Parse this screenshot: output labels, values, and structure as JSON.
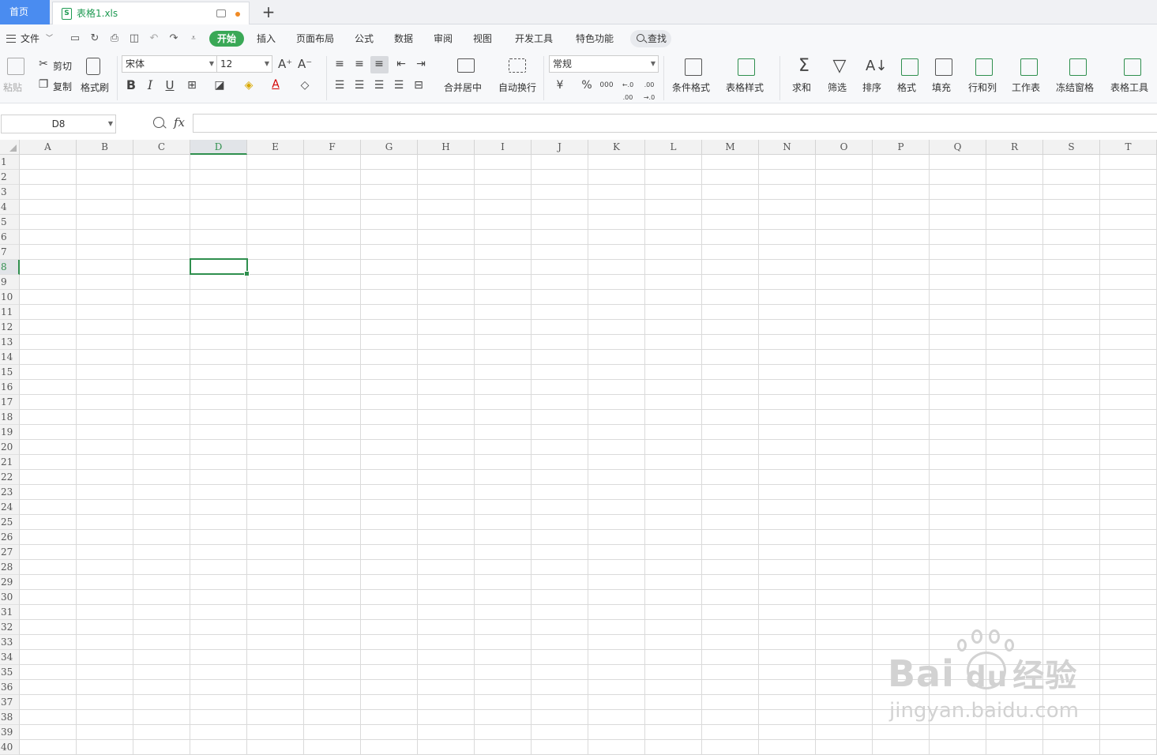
{
  "tabs": {
    "home_label": "首页",
    "doc_title": "表格1.xls",
    "doc_icon": "S"
  },
  "menu": {
    "file": "文件",
    "items": [
      "开始",
      "插入",
      "页面布局",
      "公式",
      "数据",
      "审阅",
      "视图",
      "开发工具",
      "特色功能"
    ],
    "search": "查找"
  },
  "ribbon": {
    "paste": "粘贴",
    "cut": "剪切",
    "copy": "复制",
    "format_painter": "格式刷",
    "font_name": "宋体",
    "font_size": "12",
    "bold": "B",
    "italic": "I",
    "underline": "U",
    "merge_center": "合并居中",
    "wrap_text": "自动换行",
    "number_format": "常规",
    "currency": "¥",
    "percent": "%",
    "thousands": "000",
    "dec_inc": "←.0 .00",
    "dec_dec": ".00 →.0",
    "conditional_format": "条件格式",
    "table_style": "表格样式",
    "sum": "求和",
    "filter": "筛选",
    "sort": "排序",
    "format": "格式",
    "fill": "填充",
    "row_col": "行和列",
    "worksheet": "工作表",
    "freeze": "冻结窗格",
    "table_tools": "表格工具"
  },
  "formula_bar": {
    "name_box": "D8",
    "fx": "fx",
    "value": ""
  },
  "sheet": {
    "columns": [
      "A",
      "B",
      "C",
      "D",
      "E",
      "F",
      "G",
      "H",
      "I",
      "J",
      "K",
      "L",
      "M",
      "N",
      "O",
      "P",
      "Q",
      "R",
      "S",
      "T"
    ],
    "rows": [
      "1",
      "2",
      "3",
      "4",
      "5",
      "6",
      "7",
      "8",
      "9",
      "10",
      "11",
      "12",
      "13",
      "14",
      "15",
      "16",
      "17",
      "18",
      "19",
      "20",
      "21",
      "22",
      "23",
      "24",
      "25",
      "26",
      "27",
      "28",
      "29",
      "30",
      "31",
      "32",
      "33",
      "34",
      "35",
      "36",
      "37",
      "38",
      "39",
      "40"
    ],
    "active_col": "D",
    "active_row": "8"
  },
  "watermark": {
    "main": "Bai",
    "main2": "du",
    "cn": "经验",
    "sub": "jingyan.baidu.com"
  },
  "colors": {
    "accent_green": "#2f8f4e",
    "home_tab_blue": "#4a8cf0"
  }
}
